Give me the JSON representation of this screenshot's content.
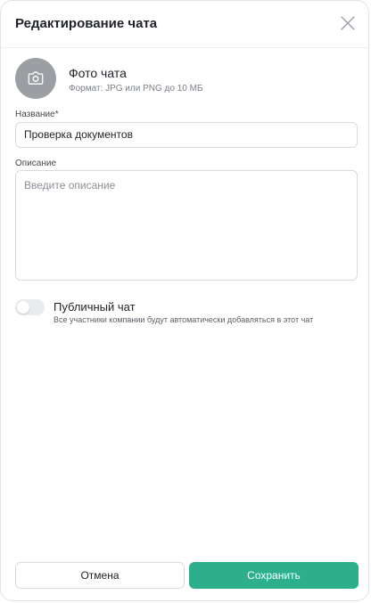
{
  "dialog": {
    "title": "Редактирование чата"
  },
  "photo": {
    "title": "Фото чата",
    "hint": "Формат: JPG или PNG до 10 МБ"
  },
  "name_field": {
    "label": "Название*",
    "value": "Проверка документов"
  },
  "description_field": {
    "label": "Описание",
    "value": "",
    "placeholder": "Введите описание"
  },
  "public_toggle": {
    "title": "Публичный чат",
    "description": "Все участники компании будут автоматически добавляться в этот чат",
    "enabled": false
  },
  "buttons": {
    "cancel": "Отмена",
    "save": "Сохранить"
  },
  "colors": {
    "accent": "#2daf8c",
    "avatar_bg": "#9b9fa4"
  },
  "icons": {
    "close": "close-icon",
    "camera": "camera-icon"
  }
}
